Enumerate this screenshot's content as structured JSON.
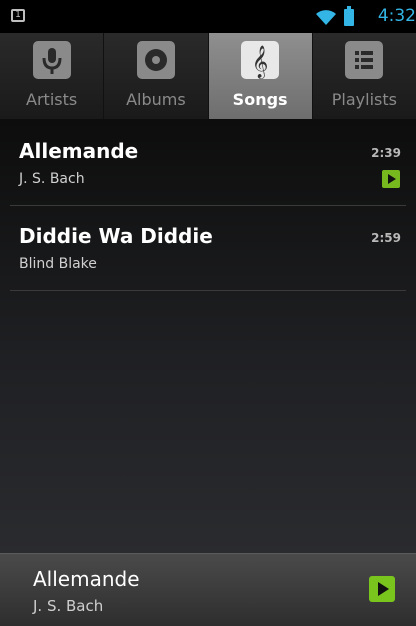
{
  "status_bar": {
    "sim_indicator": "1",
    "time": "4:32",
    "icons": [
      "sim-card-icon",
      "wifi-icon",
      "battery-icon"
    ]
  },
  "tabs": [
    {
      "label": "Artists",
      "icon": "microphone-icon",
      "active": false
    },
    {
      "label": "Albums",
      "icon": "album-disc-icon",
      "active": false
    },
    {
      "label": "Songs",
      "icon": "treble-clef-icon",
      "active": true
    },
    {
      "label": "Playlists",
      "icon": "playlist-icon",
      "active": false
    }
  ],
  "songs": [
    {
      "title": "Allemande",
      "artist": "J. S. Bach",
      "duration": "2:39",
      "playing": true
    },
    {
      "title": "Diddie Wa Diddie",
      "artist": "Blind Blake",
      "duration": "2:59",
      "playing": false
    }
  ],
  "now_playing": {
    "title": "Allemande",
    "artist": "J. S. Bach"
  },
  "colors": {
    "accent_blue": "#33b5e5",
    "play_green": "#7ac41e",
    "background": "#000000"
  }
}
